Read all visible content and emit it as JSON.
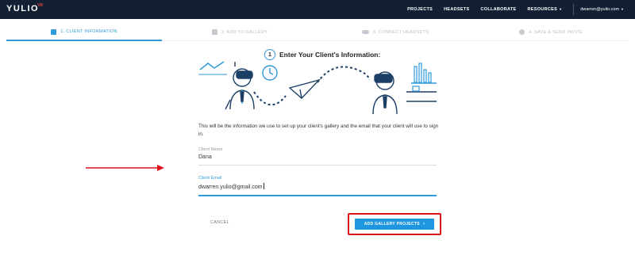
{
  "app": {
    "logo_text": "YULIO",
    "logo_sup": "VR"
  },
  "nav": {
    "items": [
      {
        "label": "PROJECTS"
      },
      {
        "label": "HEADSETS"
      },
      {
        "label": "COLLABORATE"
      },
      {
        "label": "RESOURCES"
      }
    ],
    "user_email": "dwarren@yulio.com"
  },
  "steps": [
    {
      "label": "1. CLIENT INFORMATION",
      "icon": "user-icon",
      "active": true
    },
    {
      "label": "2. ADD TO GALLERY",
      "icon": "gallery-icon",
      "active": false
    },
    {
      "label": "3. CONNECT HEADSETS",
      "icon": "headset-icon",
      "active": false
    },
    {
      "label": "4. SAVE & SEND INVITE",
      "icon": "check-icon",
      "active": false
    }
  ],
  "main": {
    "step_number": "1",
    "heading": "Enter Your Client's Information:",
    "intro": "This will be the information we use to set up your client's gallery and the email that your client will use to sign in.",
    "client_name": {
      "label": "Client Name",
      "value": "Dana"
    },
    "client_email": {
      "label": "Client Email",
      "value": "dwarren.yulio@gmail.com"
    }
  },
  "actions": {
    "cancel_label": "CANCEL",
    "primary_label": "ADD GALLERY PROJECTS"
  },
  "colors": {
    "navbar": "#131f33",
    "accent": "#2f9ad8",
    "primary_button": "#1e97e0",
    "annotation_red": "#d8141a"
  }
}
